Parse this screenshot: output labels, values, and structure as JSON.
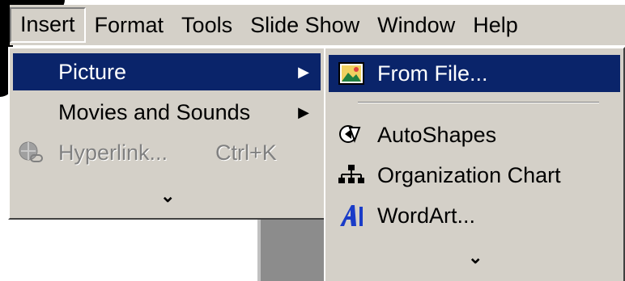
{
  "menubar": {
    "items": [
      {
        "label": "Insert"
      },
      {
        "label": "Format"
      },
      {
        "label": "Tools"
      },
      {
        "label": "Slide Show"
      },
      {
        "label": "Window"
      },
      {
        "label": "Help"
      }
    ]
  },
  "insert_menu": {
    "items": [
      {
        "label": "Picture",
        "state": "selected",
        "has_submenu": true
      },
      {
        "label": "Movies and Sounds",
        "has_submenu": true
      },
      {
        "label": "Hyperlink...",
        "shortcut": "Ctrl+K",
        "state": "disabled"
      }
    ],
    "expand_icon": "double-chevron-down"
  },
  "picture_submenu": {
    "items": [
      {
        "label": "From File...",
        "state": "selected",
        "icon": "picture-from-file-icon"
      },
      {
        "label": "AutoShapes",
        "icon": "autoshapes-icon"
      },
      {
        "label": "Organization Chart",
        "icon": "org-chart-icon"
      },
      {
        "label": "WordArt...",
        "icon": "wordart-icon"
      }
    ],
    "expand_icon": "double-chevron-down"
  },
  "colors": {
    "selection": "#0a246a",
    "menu_face": "#d4d0c8"
  }
}
